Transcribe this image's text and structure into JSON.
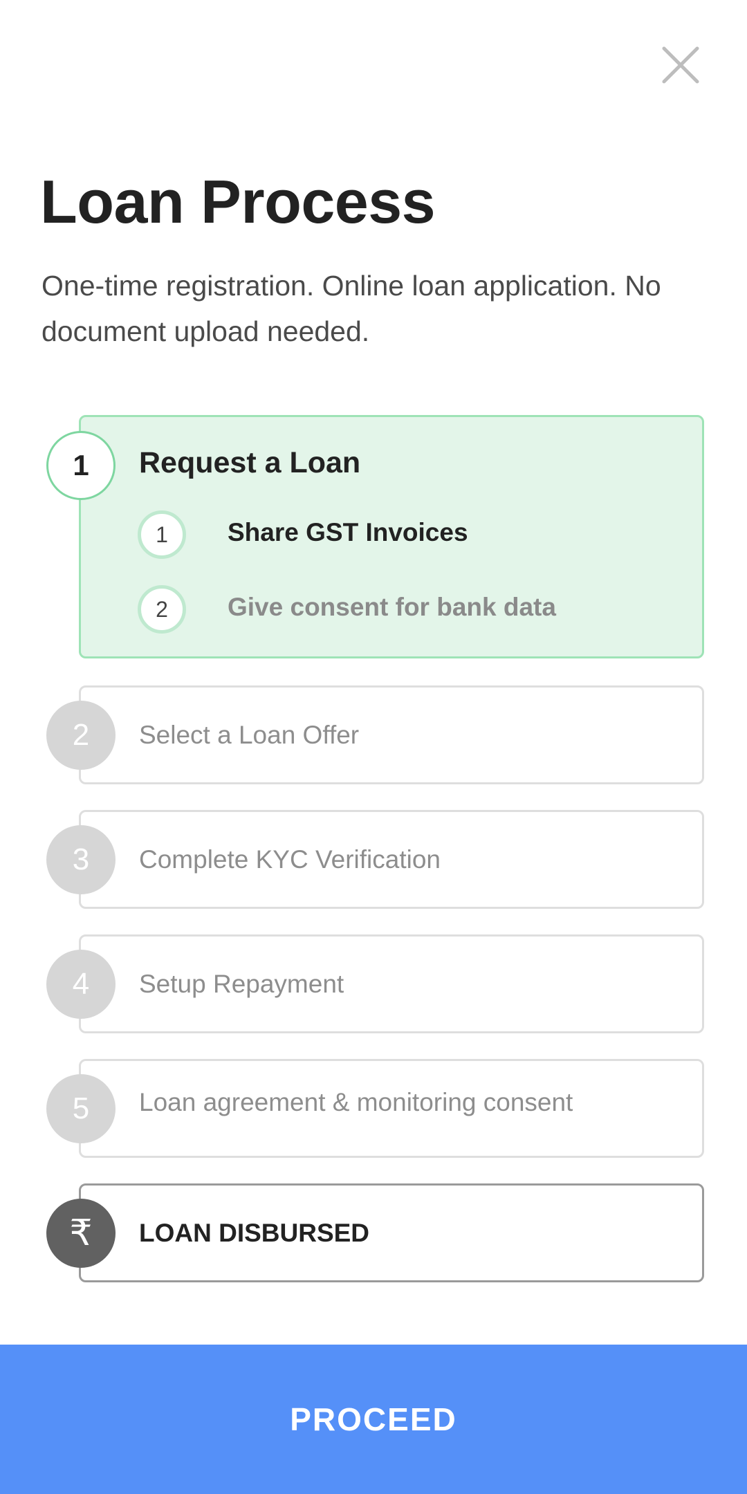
{
  "header": {
    "close_icon": "close-icon",
    "title": "Loan Process",
    "subtitle": "One-time registration. Online loan application. No document upload needed."
  },
  "colors": {
    "active_bg": "#e3f5e9",
    "active_border": "#9ee3b6",
    "pending_badge": "#d6d6d6",
    "final_badge": "#616161",
    "primary": "#5590f8"
  },
  "steps": [
    {
      "number": "1",
      "title": "Request a Loan",
      "status": "active",
      "substeps": [
        {
          "number": "1",
          "label": "Share GST Invoices",
          "status": "current"
        },
        {
          "number": "2",
          "label": "Give consent for bank data",
          "status": "pending"
        }
      ]
    },
    {
      "number": "2",
      "title": "Select a Loan Offer",
      "status": "pending"
    },
    {
      "number": "3",
      "title": "Complete KYC Verification",
      "status": "pending"
    },
    {
      "number": "4",
      "title": "Setup Repayment",
      "status": "pending"
    },
    {
      "number": "5",
      "title": "Loan agreement & monitoring consent",
      "status": "pending"
    }
  ],
  "final_step": {
    "icon": "rupee-icon",
    "symbol": "₹",
    "title": "LOAN DISBURSED"
  },
  "footer": {
    "proceed_label": "PROCEED"
  }
}
